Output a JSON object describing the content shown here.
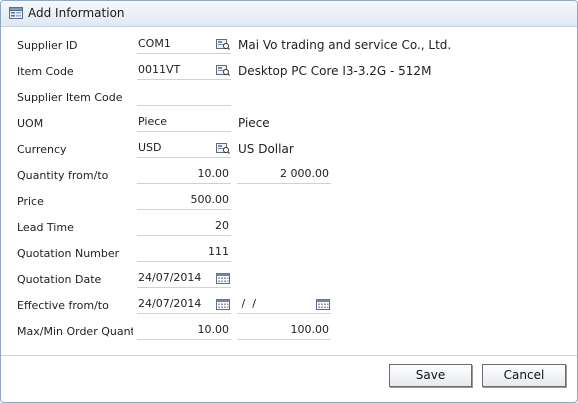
{
  "window": {
    "title": "Add Information"
  },
  "form": {
    "supplier_id": {
      "label": "Supplier ID",
      "value": "COM1",
      "description": "Mai Vo trading and service Co., Ltd."
    },
    "item_code": {
      "label": "Item Code",
      "value": "0011VT",
      "description": "Desktop PC Core I3-3.2G - 512M"
    },
    "supplier_item_code": {
      "label": "Supplier Item Code",
      "value": ""
    },
    "uom": {
      "label": "UOM",
      "value": "Piece",
      "description": "Piece"
    },
    "currency": {
      "label": "Currency",
      "value": "USD",
      "description": "US Dollar"
    },
    "quantity": {
      "label": "Quantity from/to",
      "from": "10.00",
      "to": "2 000.00"
    },
    "price": {
      "label": "Price",
      "value": "500.00"
    },
    "lead_time": {
      "label": "Lead Time",
      "value": "20"
    },
    "quotation_number": {
      "label": "Quotation Number",
      "value": "111"
    },
    "quotation_date": {
      "label": "Quotation Date",
      "value": "24/07/2014"
    },
    "effective": {
      "label": "Effective from/to",
      "from": "24/07/2014",
      "to": " /  /"
    },
    "order_quantity": {
      "label": "Max/Min Order Quantity",
      "max": "10.00",
      "min": "100.00"
    }
  },
  "buttons": {
    "save": "Save",
    "cancel": "Cancel"
  },
  "icons": {
    "title": "form-window-icon",
    "lookup": "lookup-icon",
    "calendar": "calendar-icon"
  }
}
